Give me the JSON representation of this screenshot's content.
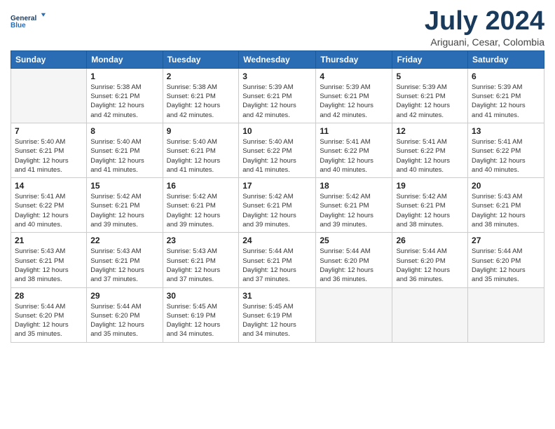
{
  "logo": {
    "line1": "General",
    "line2": "Blue"
  },
  "title": "July 2024",
  "subtitle": "Ariguani, Cesar, Colombia",
  "weekdays": [
    "Sunday",
    "Monday",
    "Tuesday",
    "Wednesday",
    "Thursday",
    "Friday",
    "Saturday"
  ],
  "weeks": [
    [
      {
        "day": "",
        "info": ""
      },
      {
        "day": "1",
        "info": "Sunrise: 5:38 AM\nSunset: 6:21 PM\nDaylight: 12 hours\nand 42 minutes."
      },
      {
        "day": "2",
        "info": "Sunrise: 5:38 AM\nSunset: 6:21 PM\nDaylight: 12 hours\nand 42 minutes."
      },
      {
        "day": "3",
        "info": "Sunrise: 5:39 AM\nSunset: 6:21 PM\nDaylight: 12 hours\nand 42 minutes."
      },
      {
        "day": "4",
        "info": "Sunrise: 5:39 AM\nSunset: 6:21 PM\nDaylight: 12 hours\nand 42 minutes."
      },
      {
        "day": "5",
        "info": "Sunrise: 5:39 AM\nSunset: 6:21 PM\nDaylight: 12 hours\nand 42 minutes."
      },
      {
        "day": "6",
        "info": "Sunrise: 5:39 AM\nSunset: 6:21 PM\nDaylight: 12 hours\nand 41 minutes."
      }
    ],
    [
      {
        "day": "7",
        "info": "Sunrise: 5:40 AM\nSunset: 6:21 PM\nDaylight: 12 hours\nand 41 minutes."
      },
      {
        "day": "8",
        "info": "Sunrise: 5:40 AM\nSunset: 6:21 PM\nDaylight: 12 hours\nand 41 minutes."
      },
      {
        "day": "9",
        "info": "Sunrise: 5:40 AM\nSunset: 6:21 PM\nDaylight: 12 hours\nand 41 minutes."
      },
      {
        "day": "10",
        "info": "Sunrise: 5:40 AM\nSunset: 6:22 PM\nDaylight: 12 hours\nand 41 minutes."
      },
      {
        "day": "11",
        "info": "Sunrise: 5:41 AM\nSunset: 6:22 PM\nDaylight: 12 hours\nand 40 minutes."
      },
      {
        "day": "12",
        "info": "Sunrise: 5:41 AM\nSunset: 6:22 PM\nDaylight: 12 hours\nand 40 minutes."
      },
      {
        "day": "13",
        "info": "Sunrise: 5:41 AM\nSunset: 6:22 PM\nDaylight: 12 hours\nand 40 minutes."
      }
    ],
    [
      {
        "day": "14",
        "info": "Sunrise: 5:41 AM\nSunset: 6:22 PM\nDaylight: 12 hours\nand 40 minutes."
      },
      {
        "day": "15",
        "info": "Sunrise: 5:42 AM\nSunset: 6:21 PM\nDaylight: 12 hours\nand 39 minutes."
      },
      {
        "day": "16",
        "info": "Sunrise: 5:42 AM\nSunset: 6:21 PM\nDaylight: 12 hours\nand 39 minutes."
      },
      {
        "day": "17",
        "info": "Sunrise: 5:42 AM\nSunset: 6:21 PM\nDaylight: 12 hours\nand 39 minutes."
      },
      {
        "day": "18",
        "info": "Sunrise: 5:42 AM\nSunset: 6:21 PM\nDaylight: 12 hours\nand 39 minutes."
      },
      {
        "day": "19",
        "info": "Sunrise: 5:42 AM\nSunset: 6:21 PM\nDaylight: 12 hours\nand 38 minutes."
      },
      {
        "day": "20",
        "info": "Sunrise: 5:43 AM\nSunset: 6:21 PM\nDaylight: 12 hours\nand 38 minutes."
      }
    ],
    [
      {
        "day": "21",
        "info": "Sunrise: 5:43 AM\nSunset: 6:21 PM\nDaylight: 12 hours\nand 38 minutes."
      },
      {
        "day": "22",
        "info": "Sunrise: 5:43 AM\nSunset: 6:21 PM\nDaylight: 12 hours\nand 37 minutes."
      },
      {
        "day": "23",
        "info": "Sunrise: 5:43 AM\nSunset: 6:21 PM\nDaylight: 12 hours\nand 37 minutes."
      },
      {
        "day": "24",
        "info": "Sunrise: 5:44 AM\nSunset: 6:21 PM\nDaylight: 12 hours\nand 37 minutes."
      },
      {
        "day": "25",
        "info": "Sunrise: 5:44 AM\nSunset: 6:20 PM\nDaylight: 12 hours\nand 36 minutes."
      },
      {
        "day": "26",
        "info": "Sunrise: 5:44 AM\nSunset: 6:20 PM\nDaylight: 12 hours\nand 36 minutes."
      },
      {
        "day": "27",
        "info": "Sunrise: 5:44 AM\nSunset: 6:20 PM\nDaylight: 12 hours\nand 35 minutes."
      }
    ],
    [
      {
        "day": "28",
        "info": "Sunrise: 5:44 AM\nSunset: 6:20 PM\nDaylight: 12 hours\nand 35 minutes."
      },
      {
        "day": "29",
        "info": "Sunrise: 5:44 AM\nSunset: 6:20 PM\nDaylight: 12 hours\nand 35 minutes."
      },
      {
        "day": "30",
        "info": "Sunrise: 5:45 AM\nSunset: 6:19 PM\nDaylight: 12 hours\nand 34 minutes."
      },
      {
        "day": "31",
        "info": "Sunrise: 5:45 AM\nSunset: 6:19 PM\nDaylight: 12 hours\nand 34 minutes."
      },
      {
        "day": "",
        "info": ""
      },
      {
        "day": "",
        "info": ""
      },
      {
        "day": "",
        "info": ""
      }
    ]
  ]
}
